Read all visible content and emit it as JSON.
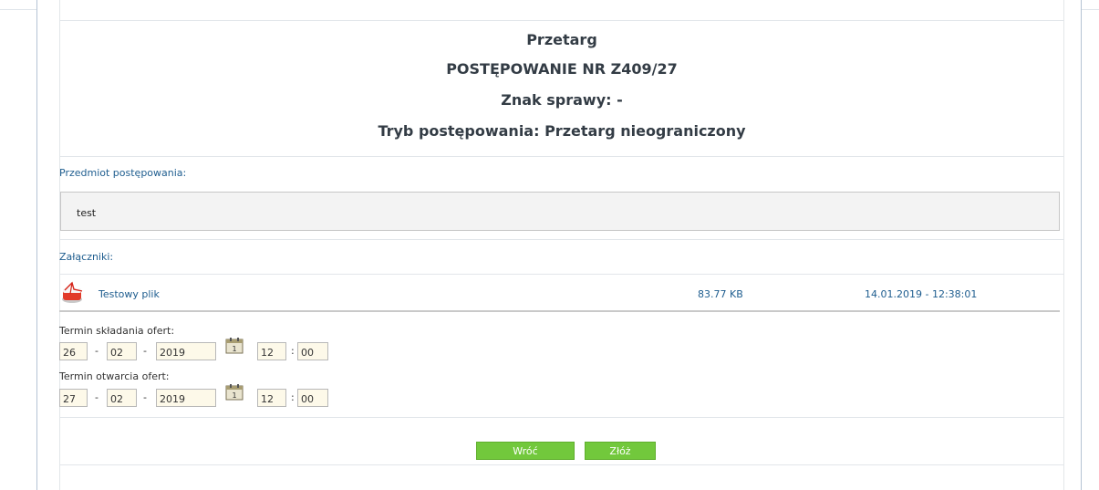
{
  "header": {
    "title": "Przetarg",
    "case_number": "POSTĘPOWANIE NR Z409/27",
    "reference": "Znak sprawy: -",
    "procedure_mode": "Tryb postępowania: Przetarg nieograniczony"
  },
  "subject": {
    "label": "Przedmiot postępowania:",
    "value": "test"
  },
  "attachments": {
    "label": "Załączniki:",
    "items": [
      {
        "name": "Testowy plik",
        "size": "83.77 KB",
        "date": "14.01.2019 - 12:38:01",
        "icon": "pdf-file-icon"
      }
    ]
  },
  "offer_deadline": {
    "label": "Termin składania ofert:",
    "day": "26",
    "month": "02",
    "year": "2019",
    "hour": "12",
    "minute": "00"
  },
  "opening_deadline": {
    "label": "Termin otwarcia ofert:",
    "day": "27",
    "month": "02",
    "year": "2019",
    "hour": "12",
    "minute": "00"
  },
  "separators": {
    "date": "-",
    "time": ":"
  },
  "buttons": {
    "back": "Wróć",
    "submit": "Złóż"
  },
  "colors": {
    "accent_green": "#72c83c",
    "link_blue": "#1e5d8f",
    "input_bg": "#fdf9e9"
  }
}
